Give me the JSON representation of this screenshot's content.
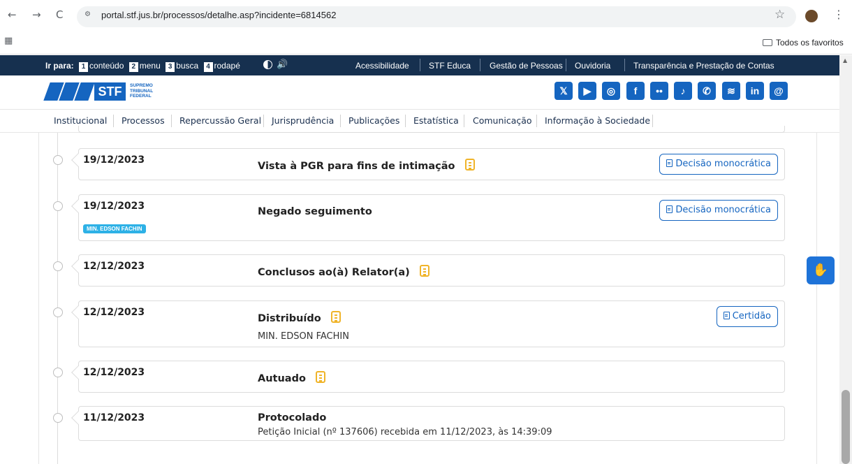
{
  "browser": {
    "back": "←",
    "forward": "→",
    "reload": "C",
    "url": "portal.stf.jus.br/processos/detalhe.asp?incidente=6814562",
    "star": "☆",
    "menu": "⋮",
    "bookmarks_folder": "Todos os favoritos"
  },
  "topbar": {
    "skip_label": "Ir para:",
    "skip_links": [
      {
        "num": "1",
        "label": "conteúdo"
      },
      {
        "num": "2",
        "label": "menu"
      },
      {
        "num": "3",
        "label": "busca"
      },
      {
        "num": "4",
        "label": "rodapé"
      }
    ],
    "links": [
      "Acessibilidade",
      "STF Educa",
      "Gestão de Pessoas",
      "Ouvidoria",
      "Transparência e Prestação de Contas"
    ]
  },
  "logo": {
    "abbr": "STF",
    "line1": "SUPREMO",
    "line2": "TRIBUNAL",
    "line3": "FEDERAL"
  },
  "social": [
    "x-icon",
    "youtube-icon",
    "instagram-icon",
    "facebook-icon",
    "flickr-icon",
    "tiktok-icon",
    "whatsapp-icon",
    "spotify-icon",
    "linkedin-icon",
    "threads-icon"
  ],
  "mainnav": [
    "Institucional",
    "Processos",
    "Repercussão Geral",
    "Jurisprudência",
    "Publicações",
    "Estatística",
    "Comunicação",
    "Informação à Sociedade"
  ],
  "timeline": [
    {
      "date": "19/12/2023",
      "title": "Vista à PGR para fins de intimação",
      "note": true,
      "button": "Decisão monocrática"
    },
    {
      "date": "19/12/2023",
      "title": "Negado seguimento",
      "badge": "MIN. EDSON FACHIN",
      "button": "Decisão monocrática"
    },
    {
      "date": "12/12/2023",
      "title": "Conclusos ao(à) Relator(a)",
      "note": true
    },
    {
      "date": "12/12/2023",
      "title": "Distribuído",
      "note": true,
      "sub": "MIN. EDSON FACHIN",
      "button": "Certidão"
    },
    {
      "date": "12/12/2023",
      "title": "Autuado",
      "note": true
    },
    {
      "date": "11/12/2023",
      "title": "Protocolado",
      "sub": "Petição Inicial (nº 137606) recebida em 11/12/2023, às 14:39:09"
    }
  ]
}
